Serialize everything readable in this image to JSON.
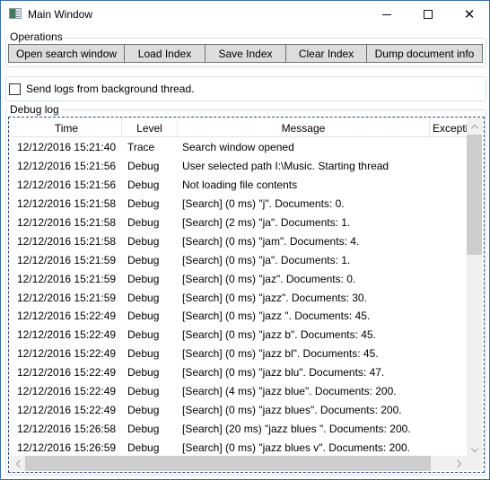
{
  "window": {
    "title": "Main Window",
    "icon": "app-window-icon",
    "controls": {
      "minimize": "minimize-icon",
      "maximize": "maximize-icon",
      "close": "close-icon"
    }
  },
  "operations": {
    "label": "Operations",
    "buttons": [
      {
        "label": "Open search window"
      },
      {
        "label": "Load Index"
      },
      {
        "label": "Save Index"
      },
      {
        "label": "Clear Index"
      },
      {
        "label": "Dump document info"
      }
    ]
  },
  "thread_option": {
    "label": "Send logs from background thread.",
    "checked": false
  },
  "debug_log": {
    "label": "Debug log",
    "columns": [
      "Time",
      "Level",
      "Message",
      "Exceptic"
    ],
    "rows": [
      {
        "time": "12/12/2016 15:21:40",
        "level": "Trace",
        "message": "Search window opened",
        "exception": ""
      },
      {
        "time": "12/12/2016 15:21:56",
        "level": "Debug",
        "message": "User selected path I:\\Music. Starting thread",
        "exception": ""
      },
      {
        "time": "12/12/2016 15:21:56",
        "level": "Debug",
        "message": "Not loading file contents",
        "exception": ""
      },
      {
        "time": "12/12/2016 15:21:58",
        "level": "Debug",
        "message": "[Search] (0 ms) \"j\". Documents: 0.",
        "exception": ""
      },
      {
        "time": "12/12/2016 15:21:58",
        "level": "Debug",
        "message": "[Search] (2 ms) \"ja\". Documents: 1.",
        "exception": ""
      },
      {
        "time": "12/12/2016 15:21:58",
        "level": "Debug",
        "message": "[Search] (0 ms) \"jam\". Documents: 4.",
        "exception": ""
      },
      {
        "time": "12/12/2016 15:21:59",
        "level": "Debug",
        "message": "[Search] (0 ms) \"ja\". Documents: 1.",
        "exception": ""
      },
      {
        "time": "12/12/2016 15:21:59",
        "level": "Debug",
        "message": "[Search] (0 ms) \"jaz\". Documents: 0.",
        "exception": ""
      },
      {
        "time": "12/12/2016 15:21:59",
        "level": "Debug",
        "message": "[Search] (0 ms) \"jazz\". Documents: 30.",
        "exception": ""
      },
      {
        "time": "12/12/2016 15:22:49",
        "level": "Debug",
        "message": "[Search] (0 ms) \"jazz \". Documents: 45.",
        "exception": ""
      },
      {
        "time": "12/12/2016 15:22:49",
        "level": "Debug",
        "message": "[Search] (0 ms) \"jazz b\". Documents: 45.",
        "exception": ""
      },
      {
        "time": "12/12/2016 15:22:49",
        "level": "Debug",
        "message": "[Search] (0 ms) \"jazz bl\". Documents: 45.",
        "exception": ""
      },
      {
        "time": "12/12/2016 15:22:49",
        "level": "Debug",
        "message": "[Search] (0 ms) \"jazz blu\". Documents: 47.",
        "exception": ""
      },
      {
        "time": "12/12/2016 15:22:49",
        "level": "Debug",
        "message": "[Search] (4 ms) \"jazz blue\". Documents: 200.",
        "exception": ""
      },
      {
        "time": "12/12/2016 15:22:49",
        "level": "Debug",
        "message": "[Search] (0 ms) \"jazz blues\". Documents: 200.",
        "exception": ""
      },
      {
        "time": "12/12/2016 15:26:58",
        "level": "Debug",
        "message": "[Search] (20 ms) \"jazz blues \". Documents: 200.",
        "exception": ""
      },
      {
        "time": "12/12/2016 15:26:59",
        "level": "Debug",
        "message": "[Search] (0 ms) \"jazz blues v\". Documents: 200.",
        "exception": ""
      }
    ]
  }
}
